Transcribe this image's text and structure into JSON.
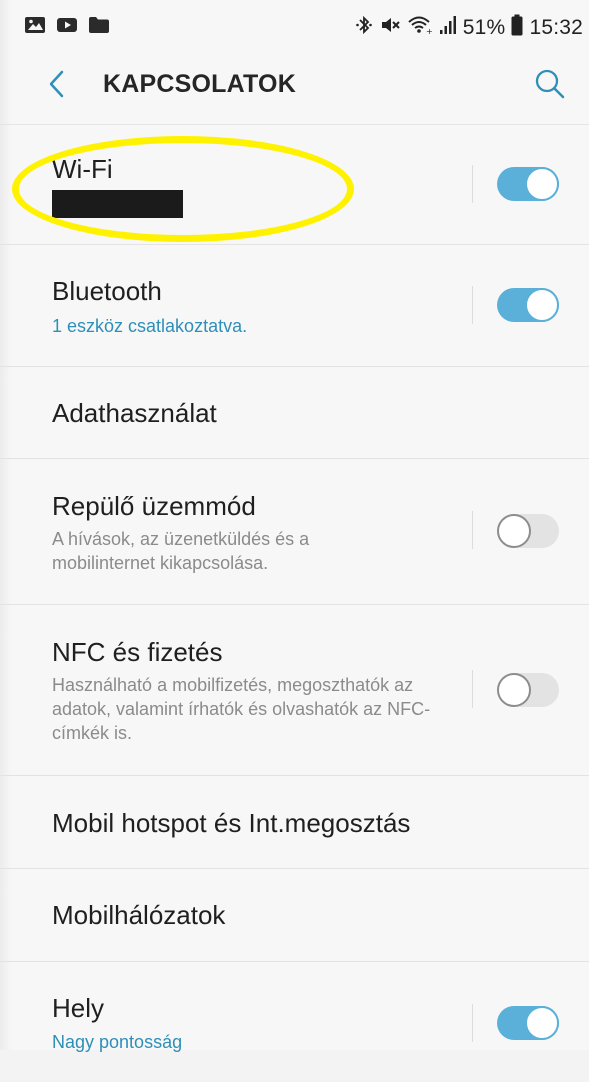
{
  "status_bar": {
    "left_icons": [
      "image-icon",
      "video-icon",
      "folder-icon"
    ],
    "right_icons": [
      "bluetooth-icon",
      "mute-icon",
      "wifi-icon",
      "signal-icon",
      "battery-icon"
    ],
    "battery_percent": "51%",
    "time": "15:32"
  },
  "appbar": {
    "title": "KAPCSOLATOK",
    "back_icon": "chevron-left-icon",
    "search_icon": "search-icon",
    "accent_color": "#2e8fb8"
  },
  "settings": [
    {
      "title": "Wi-Fi",
      "subtitle": "",
      "subtitle_redacted": true,
      "toggle": true,
      "toggle_on": true
    },
    {
      "title": "Bluetooth",
      "subtitle": "1 eszköz csatlakoztatva.",
      "subtitle_accent": true,
      "toggle": true,
      "toggle_on": true
    },
    {
      "title": "Adathasználat",
      "toggle": false
    },
    {
      "title": "Repülő üzemmód",
      "subtitle": "A hívások, az üzenetküldés és a mobilinternet kikapcsolása.",
      "toggle": true,
      "toggle_on": false
    },
    {
      "title": "NFC és fizetés",
      "subtitle": "Használható a mobilfizetés, megoszthatók az adatok, valamint írhatók és olvashatók az NFC-címkék is.",
      "toggle": true,
      "toggle_on": false
    },
    {
      "title": "Mobil hotspot és Int.megosztás",
      "toggle": false
    },
    {
      "title": "Mobilhálózatok",
      "toggle": false
    },
    {
      "title": "Hely",
      "subtitle": "Nagy pontosság",
      "subtitle_accent": true,
      "toggle": true,
      "toggle_on": true
    }
  ],
  "colors": {
    "toggle_on": "#5ab0d8",
    "toggle_off": "#e3e3e3",
    "annotation": "#fff200"
  }
}
